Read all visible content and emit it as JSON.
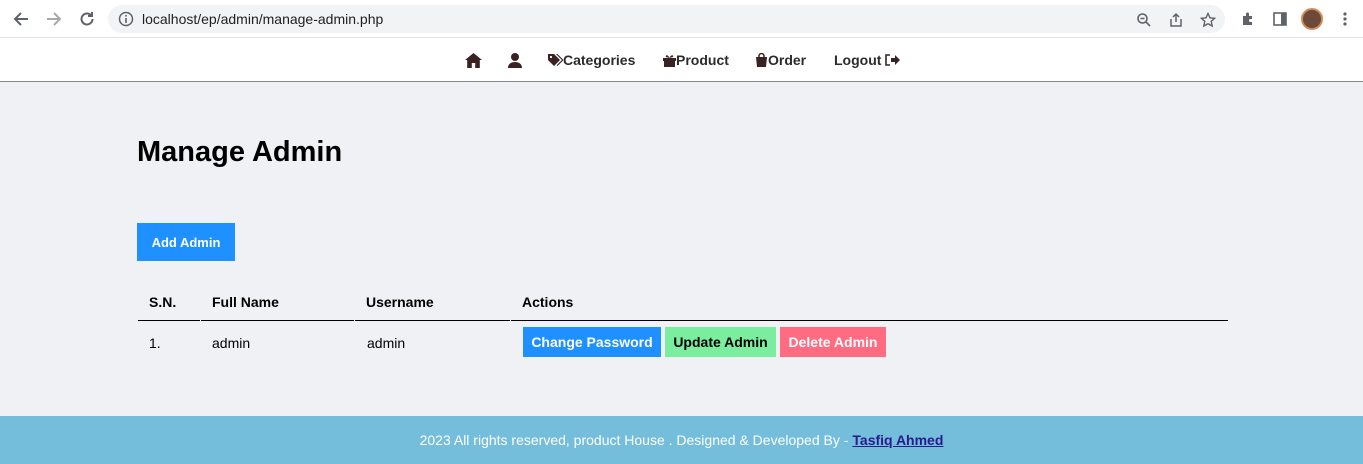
{
  "browser": {
    "url": "localhost/ep/admin/manage-admin.php"
  },
  "navbar": {
    "items": [
      {
        "label": "",
        "icon": "home-icon"
      },
      {
        "label": "",
        "icon": "user-icon"
      },
      {
        "label": "Categories",
        "icon": "tags-icon"
      },
      {
        "label": "Product",
        "icon": "gift-icon"
      },
      {
        "label": "Order",
        "icon": "shopping-bag-icon"
      },
      {
        "label": "Logout",
        "icon": "sign-out-icon"
      }
    ]
  },
  "main": {
    "title": "Manage Admin",
    "add_button": "Add Admin",
    "table": {
      "headers": [
        "S.N.",
        "Full Name",
        "Username",
        "Actions"
      ],
      "rows": [
        {
          "sn": "1.",
          "full_name": "admin",
          "username": "admin"
        }
      ],
      "actions": {
        "change_password": "Change Password",
        "update": "Update Admin",
        "delete": "Delete Admin"
      }
    }
  },
  "footer": {
    "text": "2023 All rights reserved, product House . Designed & Developed By -",
    "author": "Tasfiq Ahmed"
  },
  "colors": {
    "primary": "#1e90ff",
    "success": "#7bed9f",
    "danger": "#ff6b81",
    "footer": "#74bddb"
  }
}
